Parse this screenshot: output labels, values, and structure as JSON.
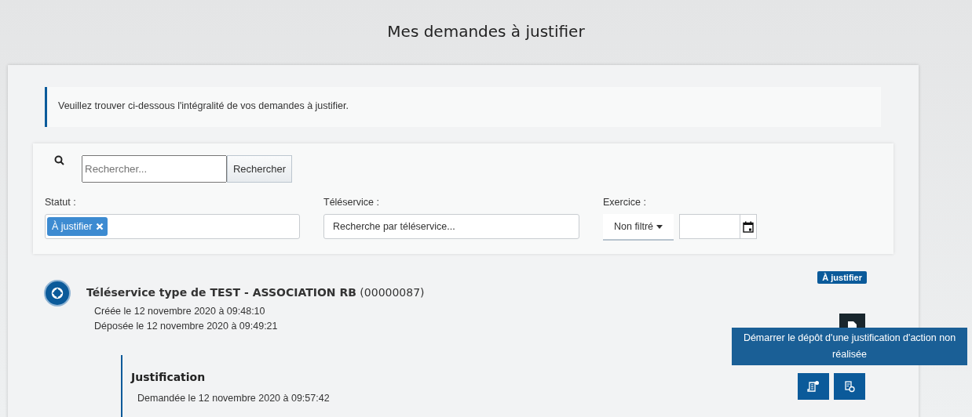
{
  "page_title": "Mes demandes à justifier",
  "notice": "Veuillez trouver ci-dessous l'intégralité de vos demandes à justifier.",
  "search": {
    "placeholder": "Rechercher...",
    "button": "Rechercher"
  },
  "filters": {
    "statut": {
      "label": "Statut :",
      "tags": [
        "À justifier"
      ]
    },
    "teleservice": {
      "label": "Téléservice :",
      "placeholder": "Recherche par téléservice..."
    },
    "exercice": {
      "label": "Exercice :",
      "dropdown": "Non filtré"
    }
  },
  "demande": {
    "title": "Téléservice type de TEST - ASSOCIATION RB",
    "number": "(00000087)",
    "status": "À justifier",
    "lines": [
      "Créée le 12 novembre 2020 à 09:48:10",
      "Déposée le 12 novembre 2020 à 09:49:21"
    ],
    "justification": {
      "title": "Justification",
      "lines": [
        "Demandée le 12 novembre 2020 à 09:57:42"
      ]
    },
    "tooltip": "Démarrer le dépôt d'une justification d'action non réalisée"
  }
}
